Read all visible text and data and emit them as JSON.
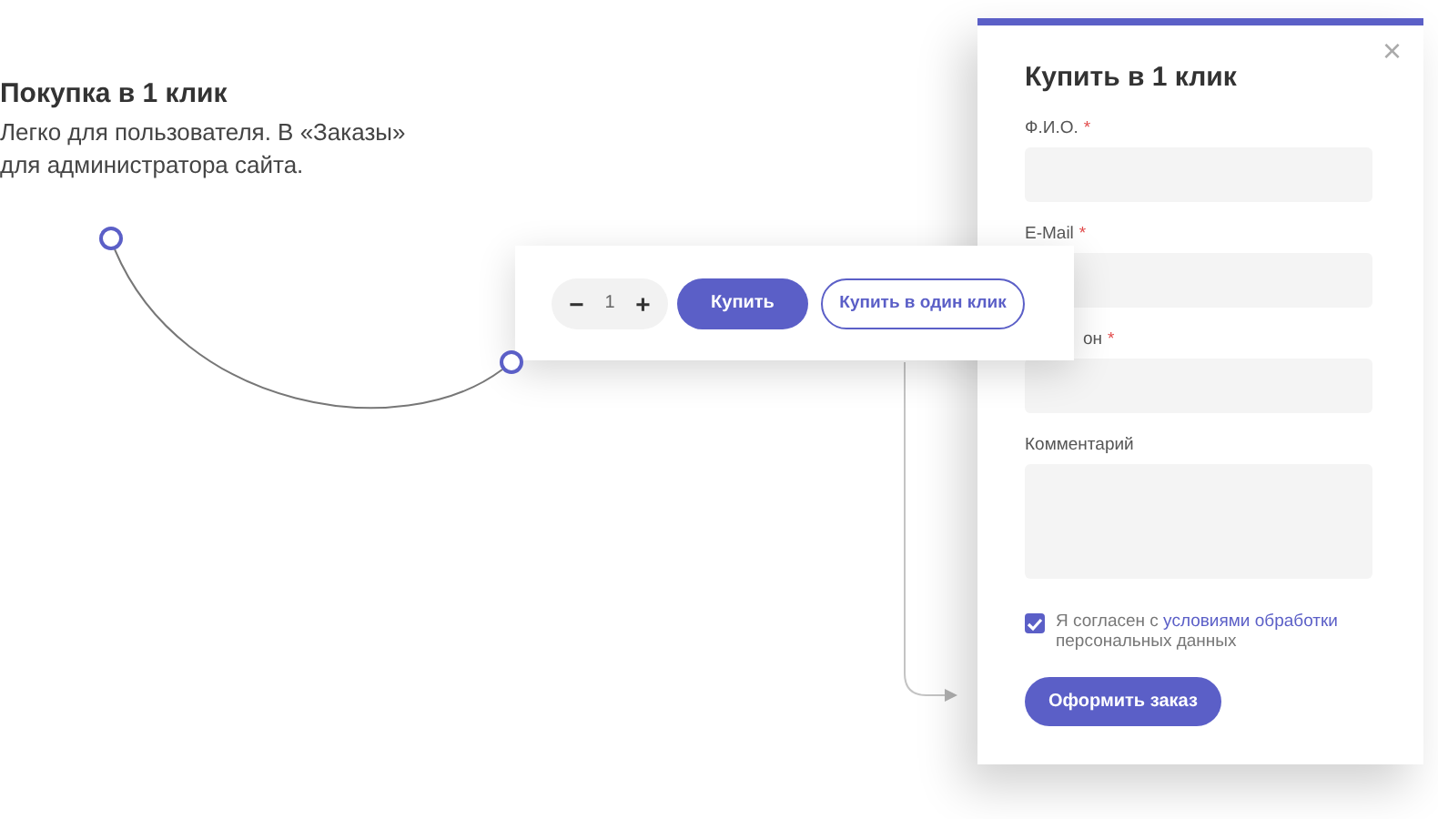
{
  "intro": {
    "title": "Покупка в 1 клик",
    "description": "Легко для пользователя. В «Заказы» для администратора сайта."
  },
  "product_card": {
    "minus": "−",
    "quantity": "1",
    "plus": "+",
    "buy_button": "Купить",
    "one_click_button": "Купить в один клик"
  },
  "modal": {
    "title": "Купить в 1 клик",
    "close": "×",
    "required_mark": "*",
    "fields": [
      {
        "label": "Ф.И.О.",
        "required": true,
        "kind": "input"
      },
      {
        "label": "E-Mail",
        "required": true,
        "kind": "input"
      },
      {
        "label": "он",
        "required": true,
        "kind": "input"
      },
      {
        "label": "Комментарий",
        "required": false,
        "kind": "textarea"
      }
    ],
    "consent": {
      "checked": true,
      "text": "Я согласен с",
      "link": "условиями обработки",
      "text_after": "персональных данных"
    },
    "submit": "Оформить заказ"
  }
}
